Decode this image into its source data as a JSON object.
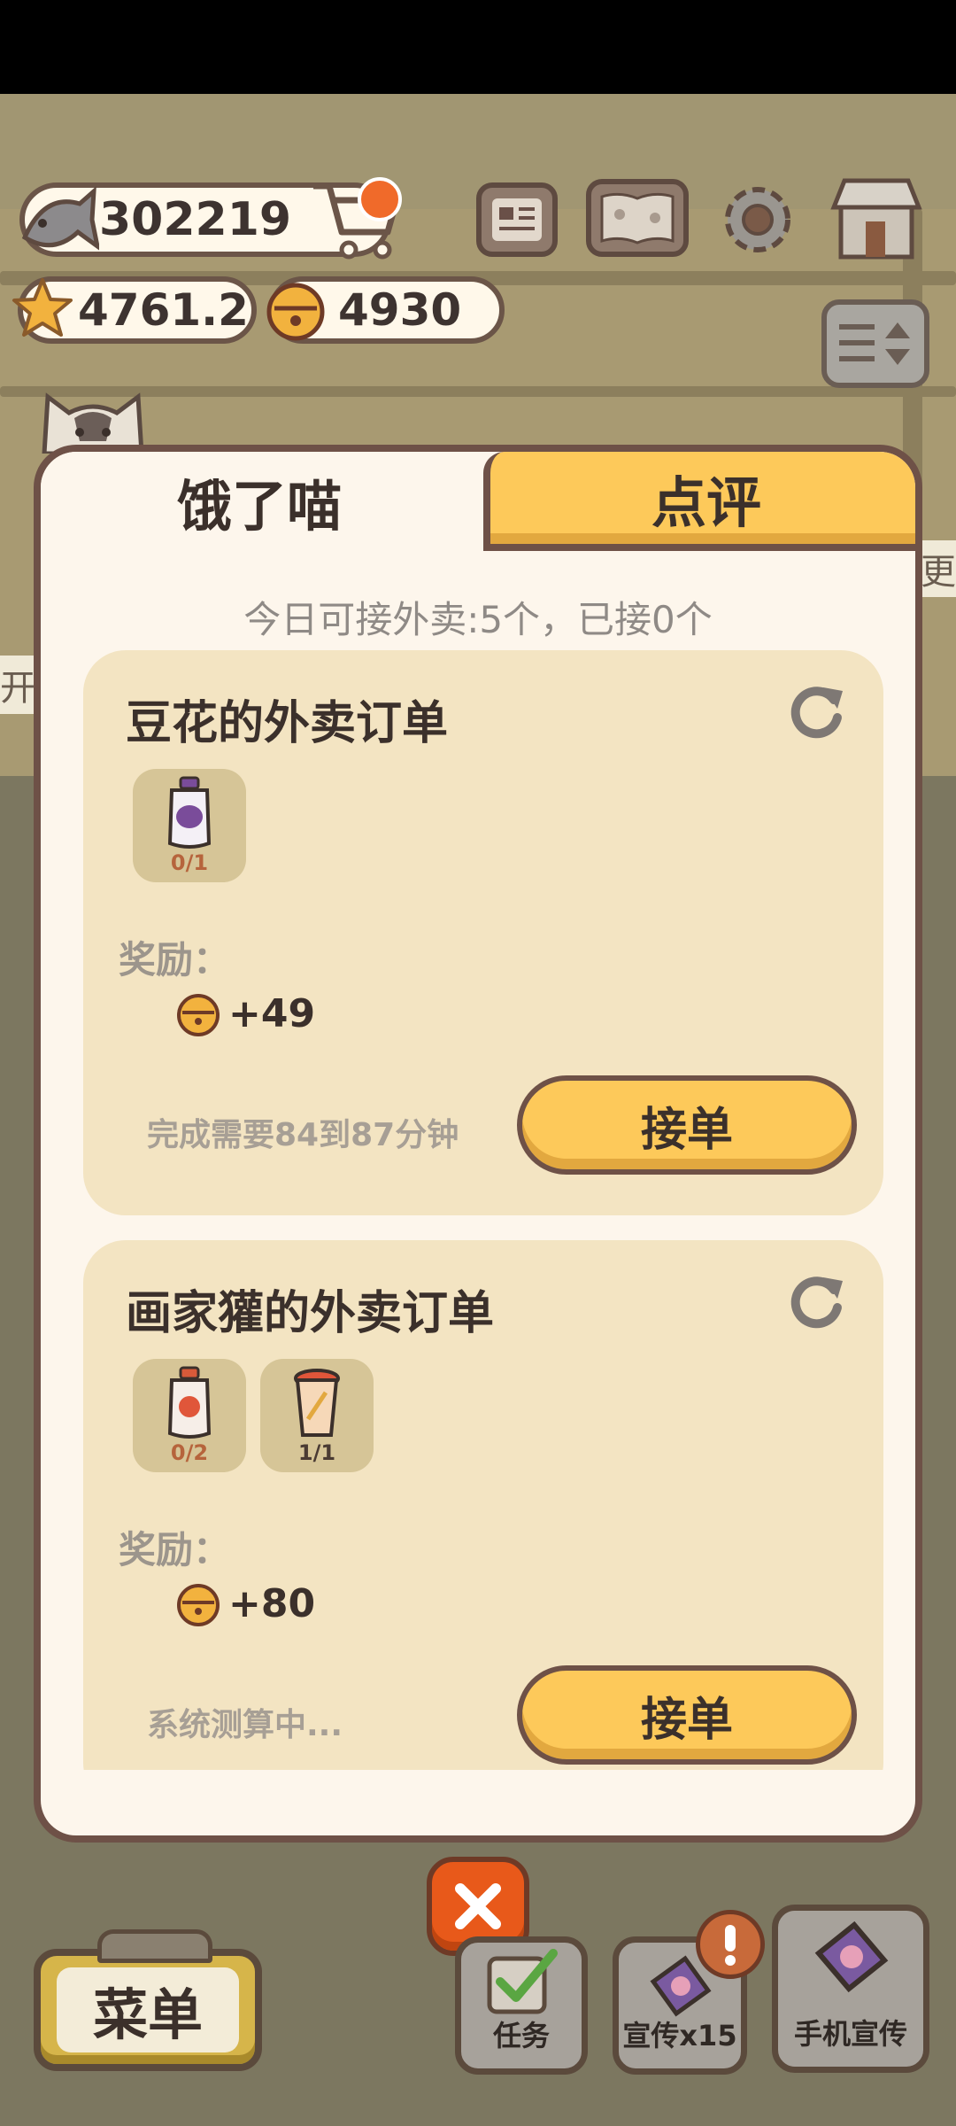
{
  "hud": {
    "fish": "302219",
    "stars": "4761.2",
    "bells": "4930",
    "icons": [
      "fish-icon",
      "cart-icon",
      "star-icon",
      "bell-icon",
      "newspaper-icon",
      "paw-book-icon",
      "gear-icon",
      "shop-icon",
      "filter-icon"
    ]
  },
  "panel": {
    "tabs": [
      "饿了喵",
      "点评"
    ],
    "quota": "今日可接外卖:5个，已接0个"
  },
  "orders": [
    {
      "title": "豆花的外卖订单",
      "items": [
        {
          "icon": "jam-jar-icon",
          "count": "0/1"
        }
      ],
      "reward_label": "奖励：",
      "reward": "+49",
      "time": "完成需要84到87分钟",
      "button": "接单"
    },
    {
      "title": "画家獾的外卖订单",
      "items": [
        {
          "icon": "sauce-jar-icon",
          "count": "0/2"
        },
        {
          "icon": "drink-cup-icon",
          "count": "1/1"
        }
      ],
      "reward_label": "奖励：",
      "reward": "+80",
      "time": "系统测算中...",
      "button": "接单"
    }
  ],
  "side_tags": {
    "left": "开",
    "right": "更"
  },
  "bottom_bar": {
    "menu": "菜单",
    "task": "任务",
    "promo": "宣传x15",
    "mobile_promo": "手机宣传"
  },
  "colors": {
    "accent_yellow": "#fdc95a",
    "panel_bg": "#fdf6ec",
    "card_bg": "#f3e4c2",
    "border_brown": "#6e5147",
    "close_orange": "#e8591a"
  }
}
